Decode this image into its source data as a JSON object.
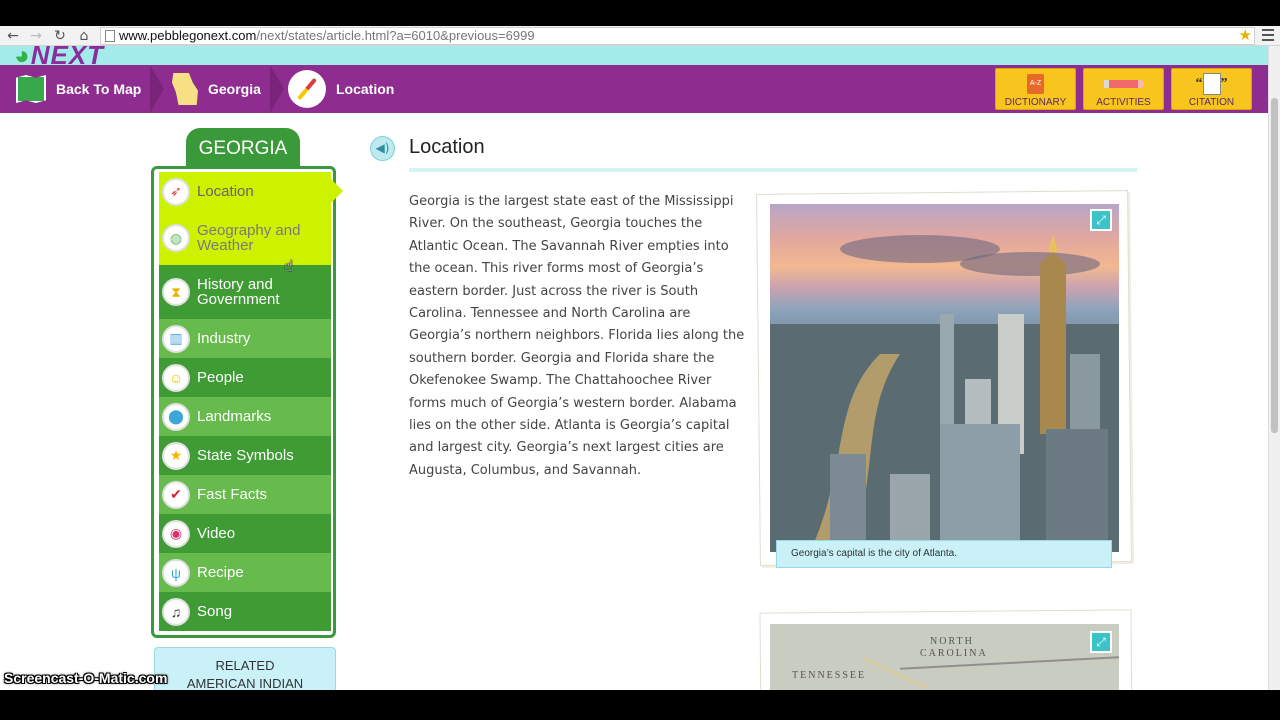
{
  "browser": {
    "url_host": "www.pebblegonext.com",
    "url_path": "/next/states/article.html?a=6010&previous=6999"
  },
  "site": {
    "logo_text": "NEXT"
  },
  "nav": {
    "crumbs": [
      {
        "label": "Back To Map",
        "icon": "map-icon"
      },
      {
        "label": "Georgia",
        "icon": "georgia-state-icon"
      },
      {
        "label": "Location",
        "icon": "compass-icon"
      }
    ],
    "tools": [
      {
        "label": "DICTIONARY",
        "icon": "dictionary-icon"
      },
      {
        "label": "ACTIVITIES",
        "icon": "pencil-icon"
      },
      {
        "label": "CITATION",
        "icon": "citation-icon"
      }
    ]
  },
  "sidebar": {
    "title": "GEORGIA",
    "items": [
      {
        "label": "Location",
        "icon": "compass-icon",
        "state": "active"
      },
      {
        "label": "Geography and Weather",
        "icon": "globe-icon",
        "state": "hover"
      },
      {
        "label": "History and Government",
        "icon": "hourglass-icon",
        "state": "normal"
      },
      {
        "label": "Industry",
        "icon": "factory-icon",
        "state": "normal"
      },
      {
        "label": "People",
        "icon": "smiley-icon",
        "state": "normal"
      },
      {
        "label": "Landmarks",
        "icon": "map-pin-icon",
        "state": "normal"
      },
      {
        "label": "State Symbols",
        "icon": "star-icon",
        "state": "normal"
      },
      {
        "label": "Fast Facts",
        "icon": "checkmark-icon",
        "state": "normal"
      },
      {
        "label": "Video",
        "icon": "video-camera-icon",
        "state": "normal"
      },
      {
        "label": "Recipe",
        "icon": "fork-knife-icon",
        "state": "normal"
      },
      {
        "label": "Song",
        "icon": "music-note-icon",
        "state": "normal"
      }
    ],
    "related_line1": "RELATED",
    "related_line2": "AMERICAN INDIAN"
  },
  "article": {
    "title": "Location",
    "body": "Georgia is the largest state east of the Mississippi River. On the southeast, Georgia touches the Atlantic Ocean. The Savannah River empties into the ocean. This river forms most of Georgia’s eastern border. Just across the river is South Carolina. Tennessee and North Carolina are Georgia’s northern neighbors. Florida lies along the southern border. Georgia and Florida share the Okefenokee Swamp. The Chattahoochee River forms much of Georgia’s western border. Alabama lies on the other side. Atlanta is Georgia’s capital and largest city. Georgia’s next largest cities are Augusta, Columbus, and Savannah.",
    "photo_caption": "Georgia’s capital is the city of Atlanta.",
    "map_labels": {
      "north": "NORTH",
      "carolina": "CAROLINA",
      "tennessee": "TENNESSEE"
    }
  },
  "overlay": {
    "watermark": "Screencast-O-Matic.com"
  },
  "colors": {
    "nav_purple": "#8e2d8f",
    "accent_cyan": "#a4ecec",
    "sidebar_green": "#3a9a3a",
    "active_lime": "#cdf200",
    "tool_yellow": "#f7c51e"
  }
}
